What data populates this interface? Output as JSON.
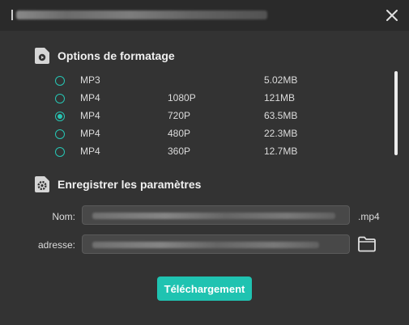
{
  "sections": {
    "format_title": "Options de formatage",
    "save_title": "Enregistrer les paramètres"
  },
  "formats": [
    {
      "format": "MP3",
      "resolution": "",
      "size": "5.02MB",
      "selected": false
    },
    {
      "format": "MP4",
      "resolution": "1080P",
      "size": "121MB",
      "selected": false
    },
    {
      "format": "MP4",
      "resolution": "720P",
      "size": "63.5MB",
      "selected": true
    },
    {
      "format": "MP4",
      "resolution": "480P",
      "size": "22.3MB",
      "selected": false
    },
    {
      "format": "MP4",
      "resolution": "360P",
      "size": "12.7MB",
      "selected": false
    }
  ],
  "save": {
    "name_label": "Nom:",
    "extension": ".mp4",
    "address_label": "adresse:"
  },
  "download_button": "Téléchargement",
  "colors": {
    "accent": "#1fc3b1",
    "background": "#333333",
    "titlebar": "#2a2a2a",
    "field": "#484848"
  },
  "icons": {
    "close": "close-icon",
    "format_section": "video-file-icon",
    "save_section": "settings-file-icon",
    "folder": "folder-icon"
  }
}
